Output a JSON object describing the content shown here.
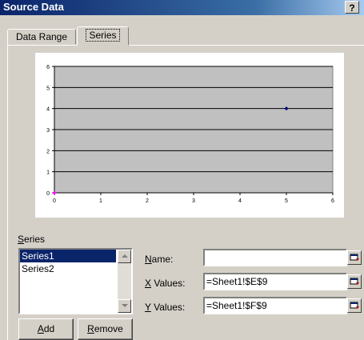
{
  "window": {
    "title": "Source Data",
    "help_label": "?"
  },
  "tabs": [
    {
      "label": "Data Range",
      "active": false
    },
    {
      "label": "Series",
      "active": true
    }
  ],
  "chart_data": {
    "type": "scatter",
    "series": [
      {
        "name": "Series1",
        "points": [
          [
            5,
            4
          ]
        ],
        "color": "#000080"
      },
      {
        "name": "Series2",
        "points": [
          [
            0,
            0
          ]
        ],
        "color": "#ff00ff"
      }
    ],
    "xlim": [
      0,
      6
    ],
    "ylim": [
      0,
      6
    ],
    "x_ticks": [
      "0",
      "1",
      "2",
      "3",
      "4",
      "5",
      "6"
    ],
    "y_ticks": [
      "0",
      "1",
      "2",
      "3",
      "4",
      "5",
      "6"
    ],
    "plot_background": "#c0c0c0",
    "grid": true
  },
  "series_panel": {
    "group_label": "Series",
    "items": [
      "Series1",
      "Series2"
    ],
    "selected_index": 0,
    "add_label": "Add",
    "remove_label": "Remove"
  },
  "fields": {
    "name": {
      "label": "Name:",
      "value": ""
    },
    "x_values": {
      "label": "X Values:",
      "value": "=Sheet1!$E$9"
    },
    "y_values": {
      "label": "Y Values:",
      "value": "=Sheet1!$F$9"
    }
  }
}
